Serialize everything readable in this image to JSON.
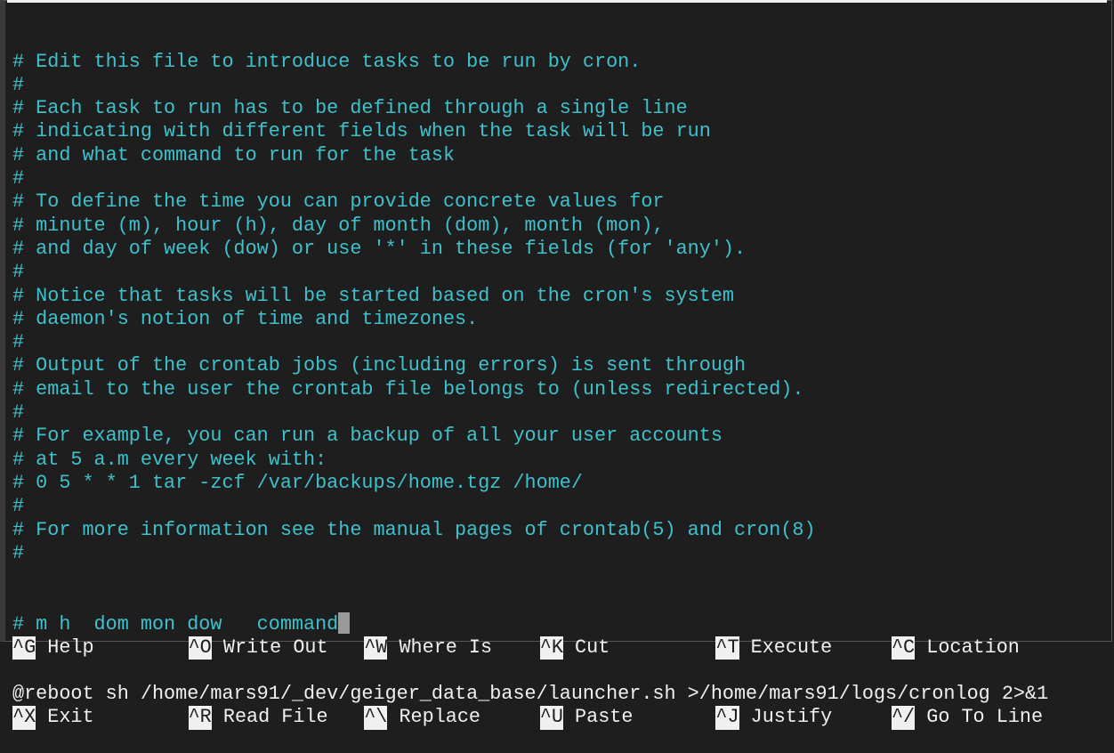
{
  "editor": {
    "comment_lines": [
      "# Edit this file to introduce tasks to be run by cron.",
      "#",
      "# Each task to run has to be defined through a single line",
      "# indicating with different fields when the task will be run",
      "# and what command to run for the task",
      "#",
      "# To define the time you can provide concrete values for",
      "# minute (m), hour (h), day of month (dom), month (mon),",
      "# and day of week (dow) or use '*' in these fields (for 'any').",
      "#",
      "# Notice that tasks will be started based on the cron's system",
      "# daemon's notion of time and timezones.",
      "#",
      "# Output of the crontab jobs (including errors) is sent through",
      "# email to the user the crontab file belongs to (unless redirected).",
      "#",
      "# For example, you can run a backup of all your user accounts",
      "# at 5 a.m every week with:",
      "# 0 5 * * 1 tar -zcf /var/backups/home.tgz /home/",
      "#",
      "# For more information see the manual pages of crontab(5) and cron(8)",
      "#"
    ],
    "header_line": "# m h  dom mon dow   command",
    "command_line": "@reboot sh /home/mars91/_dev/geiger_data_base/launcher.sh >/home/mars91/logs/cronlog 2>&1"
  },
  "shortcuts": {
    "row1": [
      {
        "key": "^G",
        "label": "Help"
      },
      {
        "key": "^O",
        "label": "Write Out"
      },
      {
        "key": "^W",
        "label": "Where Is"
      },
      {
        "key": "^K",
        "label": "Cut"
      },
      {
        "key": "^T",
        "label": "Execute"
      },
      {
        "key": "^C",
        "label": "Location"
      }
    ],
    "row2": [
      {
        "key": "^X",
        "label": "Exit"
      },
      {
        "key": "^R",
        "label": "Read File"
      },
      {
        "key": "^\\",
        "label": "Replace"
      },
      {
        "key": "^U",
        "label": "Paste"
      },
      {
        "key": "^J",
        "label": "Justify"
      },
      {
        "key": "^/",
        "label": "Go To Line"
      }
    ]
  },
  "colors": {
    "comment": "#3fc1cc",
    "background": "#1e1e1e",
    "text": "#f0f0f0"
  }
}
